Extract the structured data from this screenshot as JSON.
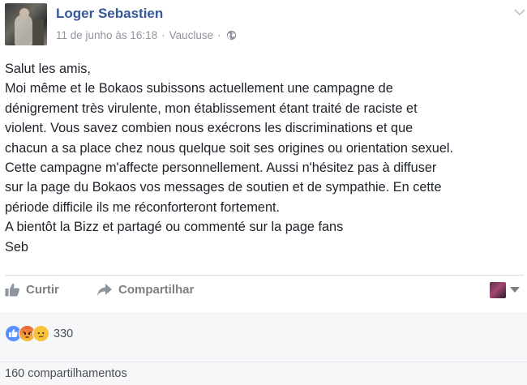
{
  "post": {
    "author": "Loger Sebastien",
    "date": "11 de junho às 16:18",
    "separator": "·",
    "location": "Vaucluse",
    "privacy_icon": "globe-icon",
    "options_icon": "chevron-down-icon",
    "lines": [
      "Salut les amis,",
      "Moi même et le Bokaos subissons actuellement une campagne de",
      "dénigrement très virulente, mon établissement étant traité de raciste et",
      "violent. Vous savez combien nous exécrons les discriminations et que",
      "chacun a sa place chez nous quelque soit ses origines ou orientation sexuel.",
      "Cette campagne m'affecte personnellement. Aussi n'hésitez pas à diffuser",
      "sur la page du Bokaos vos messages de soutien et de sympathie. En cette",
      "période difficile ils me réconforteront fortement.",
      "A bientôt la Bizz et partagé ou commenté sur la page fans",
      "Seb"
    ]
  },
  "actions": {
    "like_label": "Curtir",
    "like_icon": "thumbs-up-icon",
    "share_label": "Compartilhar",
    "share_icon": "share-arrow-icon"
  },
  "reactions": {
    "types": [
      "like",
      "angry",
      "sad"
    ],
    "count": "330"
  },
  "shares": {
    "label": "160 compartilhamentos"
  },
  "colors": {
    "author": "#365899",
    "meta": "#90949c",
    "action": "#7f7f7f",
    "like": "#5890ff",
    "footer_bg": "#f6f7f9"
  }
}
